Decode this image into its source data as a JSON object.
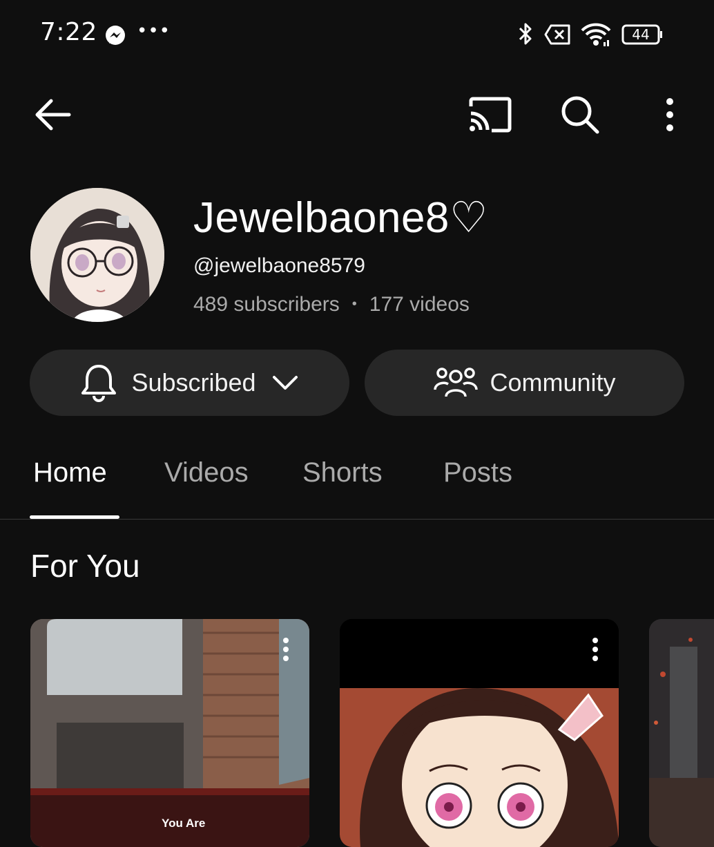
{
  "status_bar": {
    "time": "7:22",
    "overflow": "•••",
    "battery_level": "44",
    "icons": [
      "messenger-icon",
      "bluetooth-icon",
      "no-sim-icon",
      "wifi-icon",
      "battery-icon"
    ]
  },
  "app_bar": {
    "icons": [
      "back-arrow-icon",
      "cast-icon",
      "search-icon",
      "more-vertical-icon"
    ]
  },
  "channel": {
    "name": "Jewelbaone8♡",
    "handle": "@jewelbaone8579",
    "subscribers": "489 subscribers",
    "separator": "•",
    "videos": "177 videos"
  },
  "actions": {
    "subscribed_label": "Subscribed",
    "community_label": "Community"
  },
  "tabs": [
    {
      "label": "Home",
      "selected": true
    },
    {
      "label": "Videos",
      "selected": false
    },
    {
      "label": "Shorts",
      "selected": false
    },
    {
      "label": "Posts",
      "selected": false
    }
  ],
  "section": {
    "title": "For You",
    "cards": [
      {
        "caption": "You Are"
      },
      {
        "caption": ""
      },
      {
        "caption": ""
      }
    ]
  },
  "colors": {
    "background": "#0f0f0f",
    "pill": "#272727",
    "secondary_text": "#aaaaaa"
  }
}
